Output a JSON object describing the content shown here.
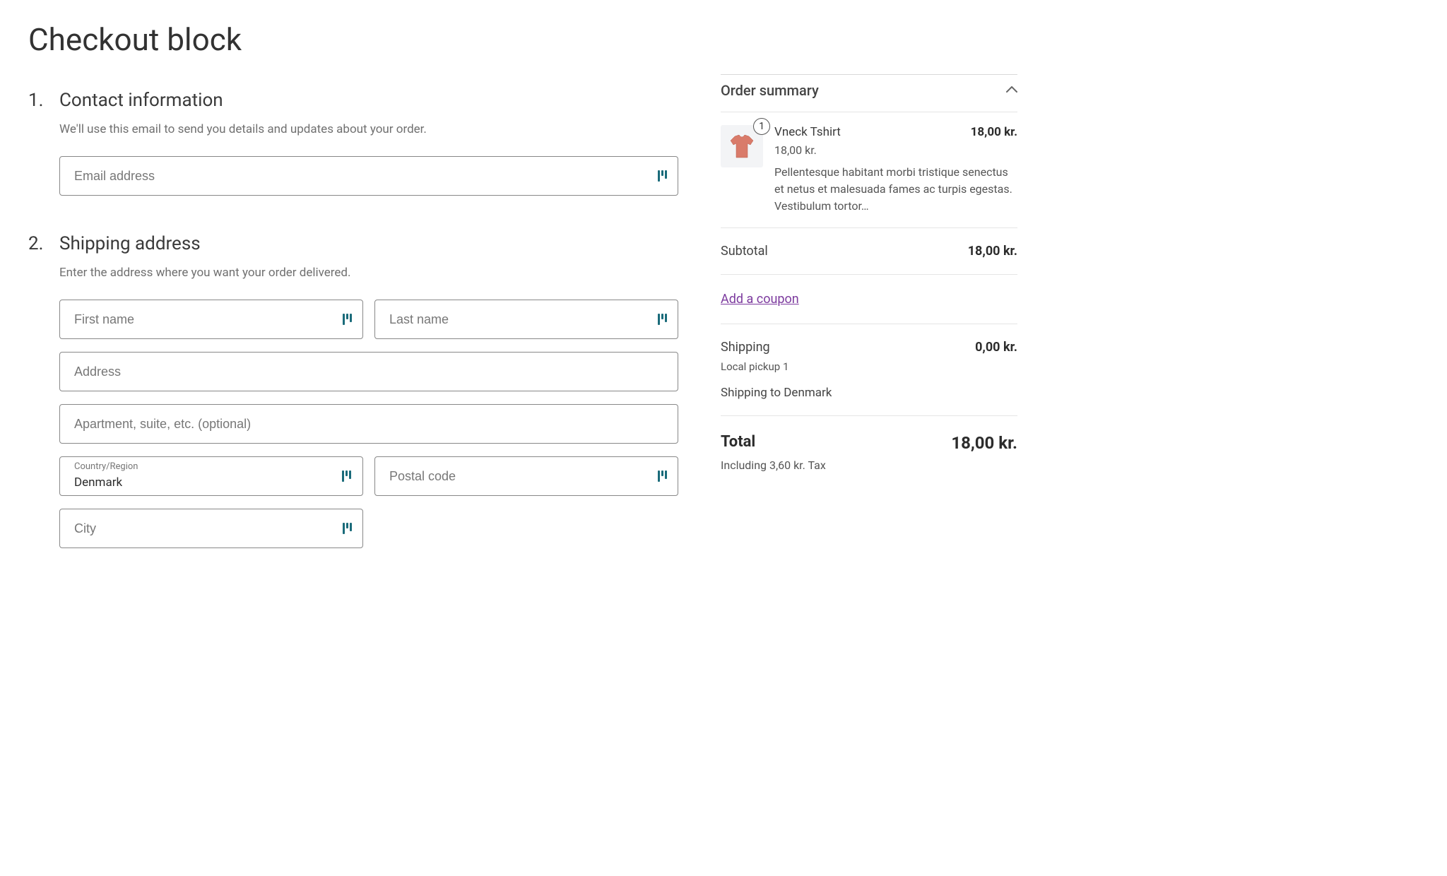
{
  "page_title": "Checkout block",
  "steps": {
    "contact": {
      "number": "1.",
      "title": "Contact information",
      "desc": "We'll use this email to send you details and updates about your order.",
      "email_placeholder": "Email address"
    },
    "shipping": {
      "number": "2.",
      "title": "Shipping address",
      "desc": "Enter the address where you want your order delivered.",
      "first_name_placeholder": "First name",
      "last_name_placeholder": "Last name",
      "address_placeholder": "Address",
      "address2_placeholder": "Apartment, suite, etc. (optional)",
      "country_label": "Country/Region",
      "country_value": "Denmark",
      "postal_placeholder": "Postal code",
      "city_placeholder": "City"
    }
  },
  "summary": {
    "title": "Order summary",
    "item": {
      "qty": "1",
      "name": "Vneck Tshirt",
      "line_price": "18,00 kr.",
      "unit_price": "18,00 kr.",
      "desc": "Pellentesque habitant morbi tristique senectus et netus et malesuada fames ac turpis egestas. Vestibulum tortor…"
    },
    "subtotal_label": "Subtotal",
    "subtotal_value": "18,00 kr.",
    "coupon_link": "Add a coupon",
    "shipping_label": "Shipping",
    "shipping_value": "0,00 kr.",
    "shipping_method": "Local pickup 1",
    "shipping_to": "Shipping to Denmark",
    "total_label": "Total",
    "total_value": "18,00 kr.",
    "tax_note": "Including 3,60 kr. Tax"
  }
}
